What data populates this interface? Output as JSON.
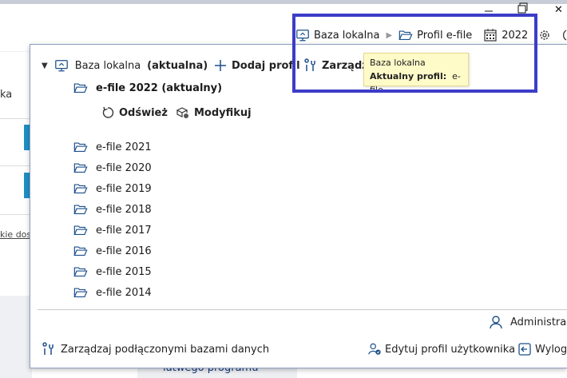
{
  "background": {
    "left_text": "ka",
    "left_link": "kie dos",
    "bottom_peek": "łatwego programu"
  },
  "window": {
    "close_glyph": "✕"
  },
  "toolbar": {
    "db_label": "Baza lokalna",
    "profile_label": "Profil e-file",
    "year_label": "2022",
    "db_icon": "monitor-icon",
    "profile_icon": "folder-open-icon",
    "year_icon": "calendar-icon",
    "settings_icon": "gear-icon"
  },
  "tooltip": {
    "line1": "Baza lokalna",
    "line2_label": "Aktualny profil:",
    "line2_value": "e-file"
  },
  "panel": {
    "database": {
      "name": "Baza lokalna",
      "status": "(aktualna)"
    },
    "add_profile": "Dodaj profil",
    "manage": "Zarządzaj",
    "current_profile": "e-file 2022 (aktualny)",
    "refresh": "Odśwież",
    "modify": "Modyfikuj",
    "profiles": [
      "e-file 2021",
      "e-file 2020",
      "e-file 2019",
      "e-file 2018",
      "e-file 2017",
      "e-file 2016",
      "e-file 2015",
      "e-file 2014"
    ],
    "footer": {
      "manage_dbs": "Zarządzaj podłączonymi bazami danych",
      "user": "Administra",
      "edit_profile": "Edytuj profil użytkownika",
      "logout": "Wylog"
    }
  },
  "colors": {
    "accent": "#3c3cc8",
    "tooltip_bg": "#fffbc8",
    "icon_blue": "#1b4f8a"
  }
}
